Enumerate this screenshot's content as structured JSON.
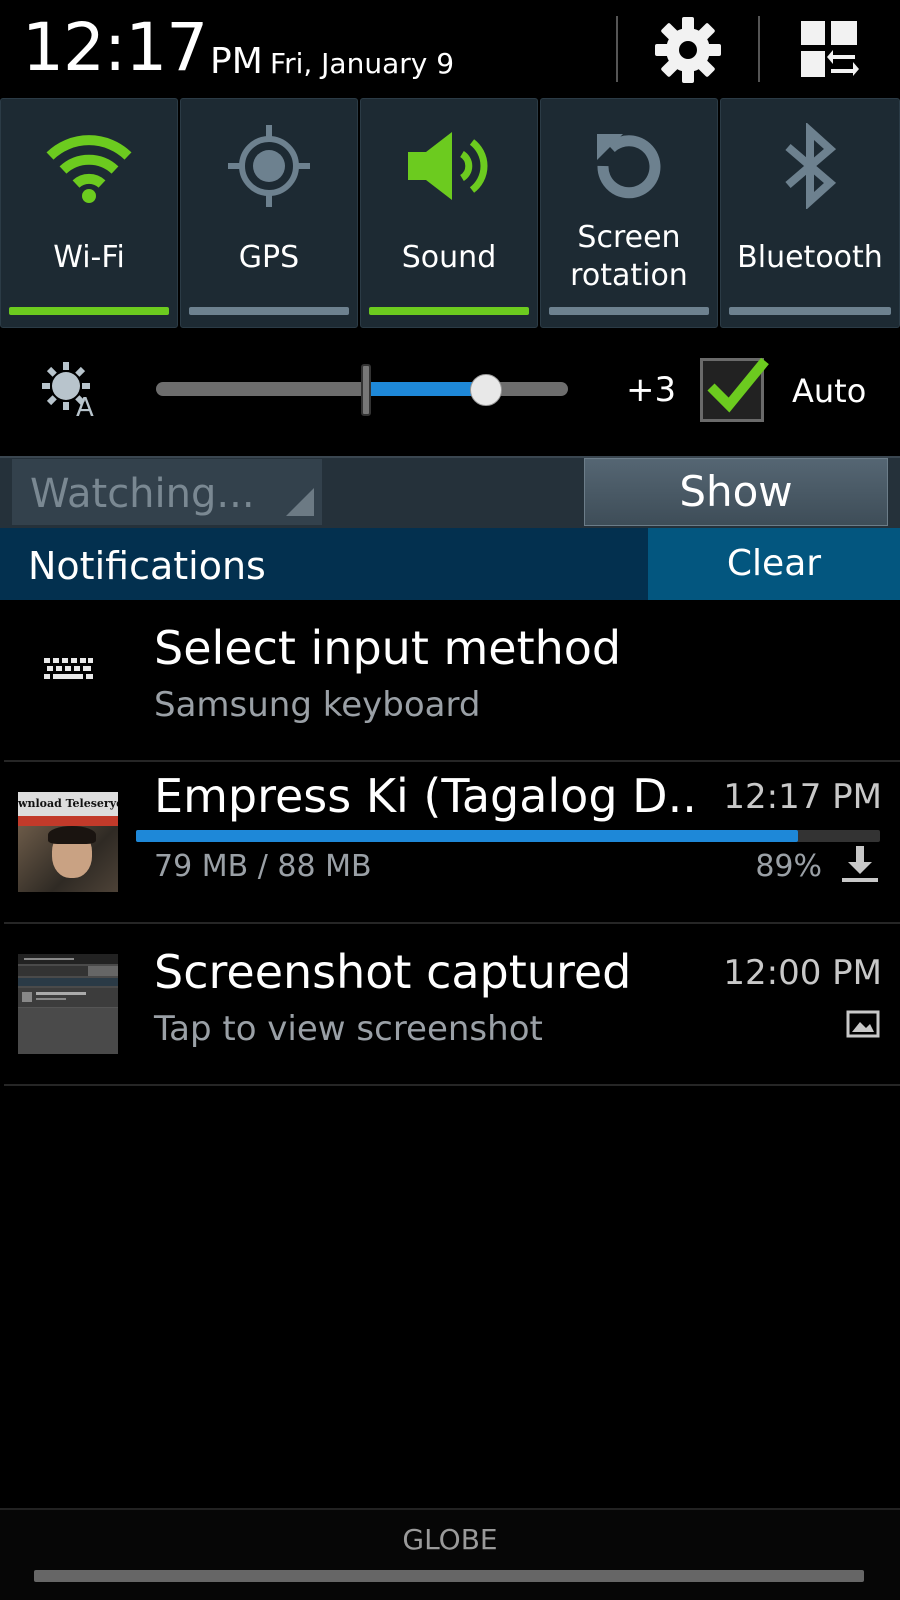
{
  "status": {
    "time": "12:17",
    "ampm": "PM",
    "date": "Fri, January 9"
  },
  "toggles": [
    {
      "label": "Wi-Fi",
      "icon": "wifi-icon",
      "on": true
    },
    {
      "label": "GPS",
      "icon": "gps-icon",
      "on": false
    },
    {
      "label": "Sound",
      "icon": "sound-icon",
      "on": true
    },
    {
      "label_line1": "Screen",
      "label_line2": "rotation",
      "icon": "rotation-icon",
      "on": false
    },
    {
      "label": "Bluetooth",
      "icon": "bluetooth-icon",
      "on": false
    }
  ],
  "brightness": {
    "value_label": "+3",
    "auto_label": "Auto",
    "auto_checked": true,
    "level_fraction": 0.8
  },
  "media_strip": {
    "dropdown_value": "Watching...",
    "show_label": "Show"
  },
  "notifications": {
    "title": "Notifications",
    "clear_label": "Clear",
    "items": [
      {
        "title": "Select input method",
        "subtitle": "Samsung keyboard",
        "icon": "keyboard-icon"
      },
      {
        "title": "Empress Ki (Tagalog D..",
        "time": "12:17 PM",
        "subtitle": "79 MB / 88 MB",
        "percent": "89%",
        "progress": 0.89,
        "icon": "download-icon",
        "thumb_text": "wnload Teleserye"
      },
      {
        "title": "Screenshot captured",
        "time": "12:00 PM",
        "subtitle": "Tap to view screenshot",
        "icon": "image-icon"
      }
    ]
  },
  "carrier": "GLOBE",
  "colors": {
    "accent_on": "#6ccb1f",
    "accent_off": "#6d818f",
    "progress": "#1e88d8",
    "notif_header": "#03304f",
    "clear_btn": "#03567f"
  }
}
